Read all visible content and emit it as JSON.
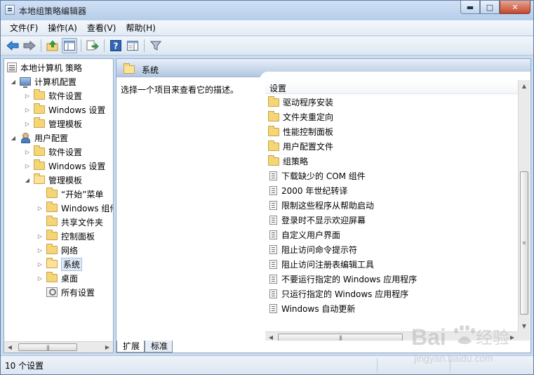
{
  "window": {
    "title": "本地组策略编辑器"
  },
  "menubar": {
    "items": [
      "文件(F)",
      "操作(A)",
      "查看(V)",
      "帮助(H)"
    ]
  },
  "toolbar": {
    "buttons": [
      "back-icon",
      "forward-icon",
      "up-folder-icon",
      "show-hide-tree-icon",
      "export-list-icon",
      "help-icon",
      "properties-pane-icon",
      "filter-icon"
    ]
  },
  "tree": {
    "root": "本地计算机 策略",
    "computer_config": "计算机配置",
    "computer_children": [
      "软件设置",
      "Windows 设置",
      "管理模板"
    ],
    "user_config": "用户配置",
    "user_children": [
      "软件设置",
      "Windows 设置",
      "管理模板"
    ],
    "admin_templates_children": [
      "“开始”菜单",
      "Windows 组件",
      "共享文件夹",
      "控制面板",
      "网络",
      "系统",
      "桌面",
      "所有设置"
    ]
  },
  "right_pane": {
    "header_title": "系统",
    "description": "选择一个项目来查看它的描述。",
    "column_header": "设置",
    "folders": [
      "驱动程序安装",
      "文件夹重定向",
      "性能控制面板",
      "用户配置文件",
      "组策略"
    ],
    "settings": [
      "下载缺少的 COM 组件",
      "2000 年世纪转译",
      "限制这些程序从帮助启动",
      "登录时不显示欢迎屏幕",
      "自定义用户界面",
      "阻止访问命令提示符",
      "阻止访问注册表编辑工具",
      "不要运行指定的 Windows 应用程序",
      "只运行指定的 Windows 应用程序",
      "Windows 自动更新"
    ]
  },
  "tabs": [
    "扩展",
    "标准"
  ],
  "status": {
    "text": "10 个设置"
  },
  "watermark": {
    "brand": "Baidu",
    "brand_cn": "经验",
    "url": "jingyan.baidu.com"
  }
}
